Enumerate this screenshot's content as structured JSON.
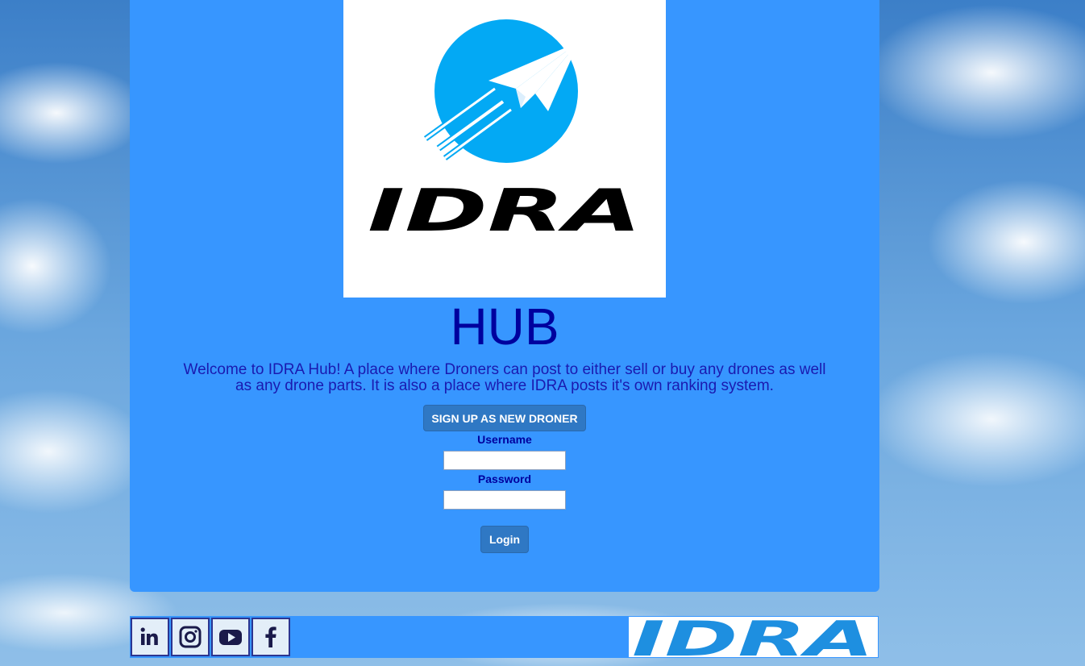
{
  "page": {
    "hub_title": "HUB",
    "welcome_text": "Welcome to IDRA Hub! A place where Droners can post to either sell or buy any drones as well as any drone parts. It is also a place where IDRA posts it's own ranking system."
  },
  "logo": {
    "brand_text": "IDRA",
    "icon": "paper-plane-rocket-icon"
  },
  "auth": {
    "signup_label": "SIGN UP AS NEW DRONER",
    "username_label": "Username",
    "username_value": "",
    "password_label": "Password",
    "password_value": "",
    "login_label": "Login"
  },
  "footer": {
    "social": [
      {
        "name": "linkedin",
        "icon": "linkedin-icon"
      },
      {
        "name": "instagram",
        "icon": "instagram-icon"
      },
      {
        "name": "youtube",
        "icon": "youtube-icon"
      },
      {
        "name": "facebook",
        "icon": "facebook-icon"
      }
    ],
    "brand_text": "IDRA"
  },
  "colors": {
    "panel": "#3796ff",
    "title": "#00009e",
    "button": "#2f78c4",
    "logo_circle": "#03a9f4",
    "footer_logo": "#1e8fe0"
  }
}
